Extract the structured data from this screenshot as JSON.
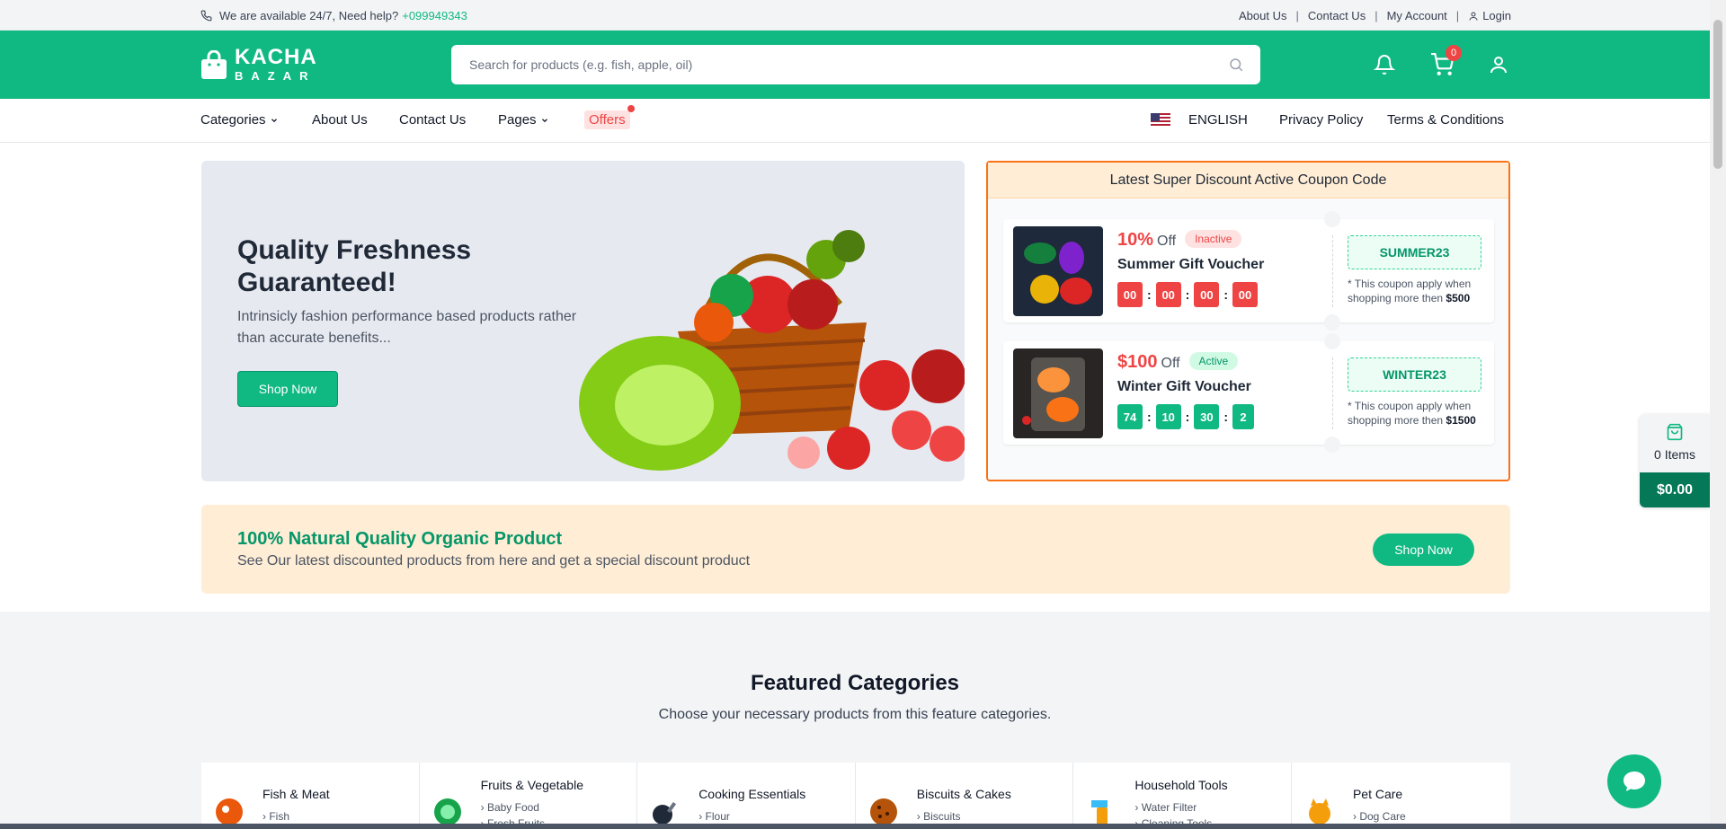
{
  "topbar": {
    "help_text": "We are available 24/7, Need help?",
    "phone": "+099949343",
    "links": [
      "About Us",
      "Contact Us",
      "My Account"
    ],
    "login": "Login",
    "separator": "|"
  },
  "header": {
    "logo_line1": "KACHA",
    "logo_line2": "BAZAR",
    "search_placeholder": "Search for products (e.g. fish, apple, oil)",
    "cart_count": "0"
  },
  "nav": {
    "categories": "Categories",
    "about": "About Us",
    "contact": "Contact Us",
    "pages": "Pages",
    "offers": "Offers",
    "language": "ENGLISH",
    "privacy": "Privacy Policy",
    "terms": "Terms & Conditions"
  },
  "hero": {
    "title": "Quality Freshness Guaranteed!",
    "description": "Intrinsicly fashion performance based products rather than accurate benefits...",
    "button": "Shop Now"
  },
  "coupons": {
    "heading": "Latest Super Discount Active Coupon Code",
    "items": [
      {
        "amount": "10%",
        "off": "Off",
        "status": "Inactive",
        "title": "Summer Gift Voucher",
        "timer": [
          "00",
          "00",
          "00",
          "00"
        ],
        "code": "SUMMER23",
        "note_prefix": "* This coupon apply when shopping more then",
        "note_amount": "$500"
      },
      {
        "amount": "$100",
        "off": "Off",
        "status": "Active",
        "title": "Winter Gift Voucher",
        "timer": [
          "74",
          "10",
          "30",
          "2"
        ],
        "code": "WINTER23",
        "note_prefix": "* This coupon apply when shopping more then",
        "note_amount": "$1500"
      }
    ]
  },
  "cart_float": {
    "items": "0 Items",
    "total": "$0.00"
  },
  "organic": {
    "title": "100% Natural Quality Organic Product",
    "subtitle": "See Our latest discounted products from here and get a special discount product",
    "button": "Shop Now"
  },
  "featured": {
    "title": "Featured Categories",
    "subtitle": "Choose your necessary products from this feature categories.",
    "categories": [
      {
        "name": "Fish & Meat",
        "subs": [
          "Fish"
        ]
      },
      {
        "name": "Fruits & Vegetable",
        "subs": [
          "Baby Food",
          "Fresh Fruits"
        ]
      },
      {
        "name": "Cooking Essentials",
        "subs": [
          "Flour"
        ]
      },
      {
        "name": "Biscuits & Cakes",
        "subs": [
          "Biscuits"
        ]
      },
      {
        "name": "Household Tools",
        "subs": [
          "Water Filter",
          "Cleaning Tools"
        ]
      },
      {
        "name": "Pet Care",
        "subs": [
          "Dog Care"
        ]
      }
    ]
  },
  "colors": {
    "brand": "#10b981",
    "accent_orange": "#f97316",
    "danger": "#ef4444"
  }
}
